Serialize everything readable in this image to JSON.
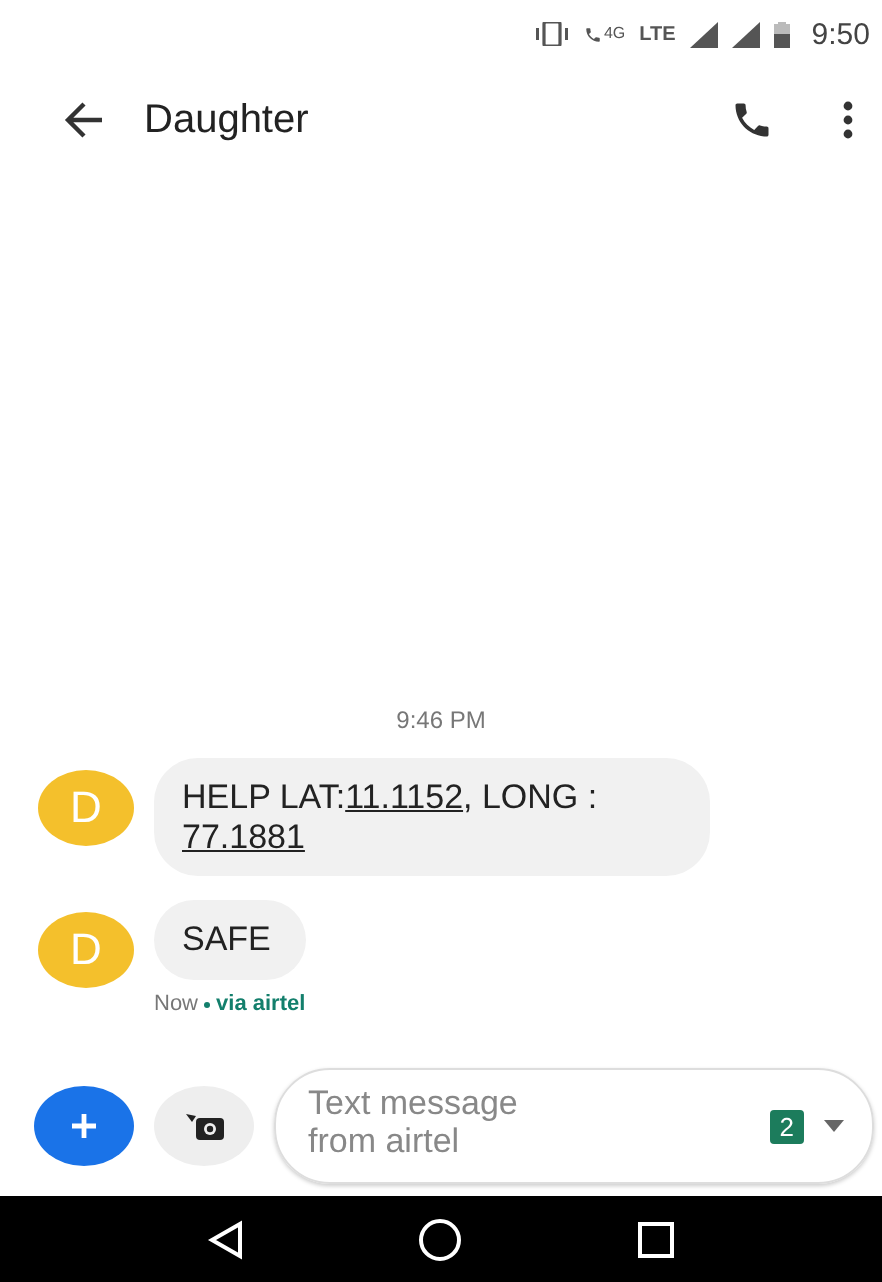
{
  "status_bar": {
    "call_badge": "4G",
    "network": "LTE",
    "time": "9:50"
  },
  "app_bar": {
    "title": "Daughter"
  },
  "conversation": {
    "timestamp": "9:46 PM",
    "messages": [
      {
        "avatar": "D",
        "segments": [
          {
            "kind": "text",
            "text": "HELP LAT:"
          },
          {
            "kind": "link",
            "text": "11.1152"
          },
          {
            "kind": "text",
            "text": ", LONG : "
          },
          {
            "kind": "link",
            "text": "77.1881"
          }
        ]
      },
      {
        "avatar": "D",
        "segments": [
          {
            "kind": "text",
            "text": "SAFE"
          }
        ],
        "meta": {
          "time": "Now",
          "via": "via airtel"
        }
      }
    ]
  },
  "compose": {
    "placeholder": "Text message from airtel",
    "sim": "2"
  }
}
